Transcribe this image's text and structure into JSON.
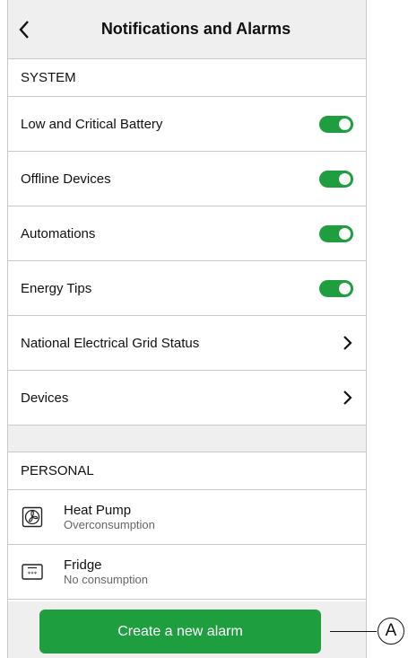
{
  "header": {
    "title": "Notifications and Alarms",
    "back_icon": "chevron-left-icon"
  },
  "system": {
    "label": "SYSTEM",
    "toggles": [
      {
        "label": "Low and Critical Battery",
        "on": true
      },
      {
        "label": "Offline Devices",
        "on": true
      },
      {
        "label": "Automations",
        "on": true
      },
      {
        "label": "Energy Tips",
        "on": true
      }
    ],
    "links": [
      {
        "label": "National Electrical Grid Status",
        "icon": "chevron-right-icon"
      },
      {
        "label": "Devices",
        "icon": "chevron-right-icon"
      }
    ]
  },
  "personal": {
    "label": "PERSONAL",
    "devices": [
      {
        "name": "Heat Pump",
        "status": "Overconsumption",
        "icon": "heat-pump-icon"
      },
      {
        "name": "Fridge",
        "status": "No consumption",
        "icon": "fridge-icon"
      }
    ]
  },
  "actions": {
    "create_label": "Create a new alarm"
  },
  "callout": {
    "label": "A"
  },
  "colors": {
    "accent": "#1e9e3e",
    "header_bg": "#efefef",
    "divider": "#c8c8c8"
  }
}
